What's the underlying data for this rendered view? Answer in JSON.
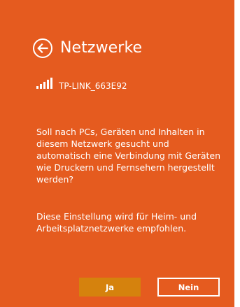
{
  "panel": {
    "title": "Netzwerke",
    "network_name": "TP-LINK_663E92",
    "question": "Soll nach PCs, Geräten und Inhalten in diesem Netzwerk gesucht und automatisch eine Verbindung mit Geräten wie Druckern und Fernsehern hergestellt werden?",
    "recommendation": "Diese Einstellung wird für Heim- und Arbeitsplatznetzwerke empfohlen.",
    "yes_label": "Ja",
    "no_label": "Nein"
  },
  "icons": {
    "back": "back-arrow-icon",
    "signal": "wifi-signal-icon"
  },
  "colors": {
    "panel_background": "#e55b1f",
    "yes_button": "#d5820d",
    "text": "#ffffff"
  }
}
